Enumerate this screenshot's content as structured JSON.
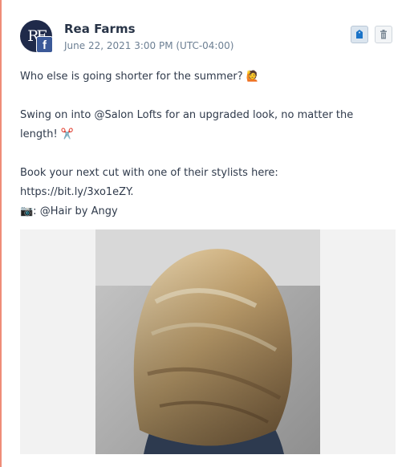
{
  "post": {
    "author": "Rea Farms",
    "avatar_initials": "RF",
    "network_icon": "facebook-icon",
    "timestamp": "June 22, 2021 3:00 PM (UTC-04:00)",
    "actions": [
      "tag-icon",
      "trash-icon"
    ],
    "lines": [
      "Who else is going shorter for the summer? 🙋",
      "",
      "Swing on into @Salon Lofts for an upgraded look, no matter the",
      "length! ✂️",
      "",
      "Book your next cut with one of their stylists here:",
      "https://bit.ly/3xo1eZY.",
      " 📷: @Hair by Angy"
    ],
    "image_icon": "photo-hair-bob-image"
  },
  "colors": {
    "accent_bar": "#ef8d78",
    "facebook": "#3b5998",
    "tag_icon": "#1a73c8"
  }
}
